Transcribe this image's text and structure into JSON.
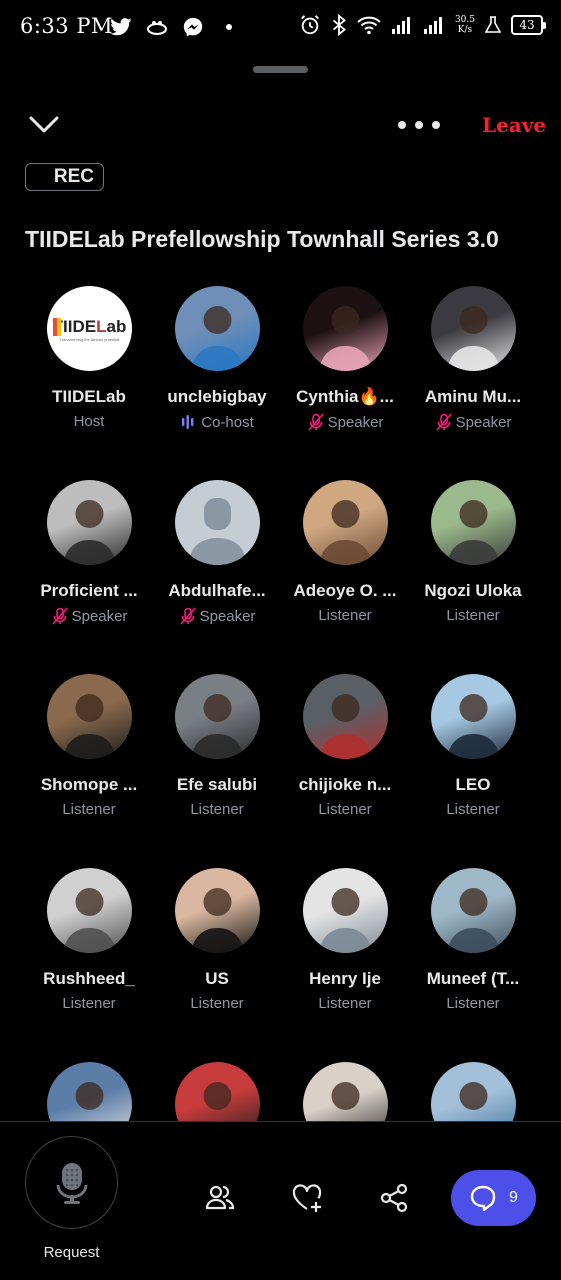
{
  "status_bar": {
    "time": "6:33 PM",
    "speed_value": "30.5",
    "speed_unit": "K/s",
    "battery": "43"
  },
  "header": {
    "leave_label": "Leave",
    "rec_label": "REC",
    "space_title": "TIIDELab Prefellowship Townhall Series 3.0"
  },
  "participants": [
    {
      "name": "TIIDELab",
      "role": "Host",
      "role_icon": "none",
      "avatar_icon": "tiidelab-logo"
    },
    {
      "name": "unclebigbay",
      "role": "Co-host",
      "role_icon": "speaking-bars-icon",
      "avatar_icon": "user-photo"
    },
    {
      "name": "Cynthia🔥...",
      "role": "Speaker",
      "role_icon": "mic-muted-icon",
      "avatar_icon": "user-photo"
    },
    {
      "name": "Aminu Mu...",
      "role": "Speaker",
      "role_icon": "mic-muted-icon",
      "avatar_icon": "user-photo"
    },
    {
      "name": "Proficient ...",
      "role": "Speaker",
      "role_icon": "mic-muted-icon",
      "avatar_icon": "user-photo"
    },
    {
      "name": "Abdulhafe...",
      "role": "Speaker",
      "role_icon": "mic-muted-icon",
      "avatar_icon": "default-avatar"
    },
    {
      "name": "Adeoye O. ...",
      "role": "Listener",
      "role_icon": "none",
      "avatar_icon": "user-photo"
    },
    {
      "name": "Ngozi Uloka",
      "role": "Listener",
      "role_icon": "none",
      "avatar_icon": "user-photo"
    },
    {
      "name": "Shomope ...",
      "role": "Listener",
      "role_icon": "none",
      "avatar_icon": "user-photo"
    },
    {
      "name": "Efe salubi",
      "role": "Listener",
      "role_icon": "none",
      "avatar_icon": "user-photo"
    },
    {
      "name": "chijioke n...",
      "role": "Listener",
      "role_icon": "none",
      "avatar_icon": "user-photo"
    },
    {
      "name": "LEO",
      "role": "Listener",
      "role_icon": "none",
      "avatar_icon": "user-photo"
    },
    {
      "name": "Rushheed_",
      "role": "Listener",
      "role_icon": "none",
      "avatar_icon": "user-photo"
    },
    {
      "name": "US",
      "role": "Listener",
      "role_icon": "none",
      "avatar_icon": "user-photo"
    },
    {
      "name": "Henry Ije",
      "role": "Listener",
      "role_icon": "none",
      "avatar_icon": "user-photo"
    },
    {
      "name": "Muneef (T...",
      "role": "Listener",
      "role_icon": "none",
      "avatar_icon": "user-photo"
    },
    {
      "name": "",
      "role": "",
      "role_icon": "none",
      "avatar_icon": "user-photo"
    },
    {
      "name": "",
      "role": "",
      "role_icon": "none",
      "avatar_icon": "user-photo"
    },
    {
      "name": "",
      "role": "",
      "role_icon": "none",
      "avatar_icon": "user-photo"
    },
    {
      "name": "",
      "role": "",
      "role_icon": "none",
      "avatar_icon": "user-photo"
    }
  ],
  "bottom_bar": {
    "request_label": "Request",
    "chat_count": "9"
  },
  "colors": {
    "background": "#000000",
    "leave": "#f4212e",
    "chat_button": "#4c4fe8",
    "cohost_accent": "#7b7ff8",
    "muted_mic": "#f91880"
  }
}
